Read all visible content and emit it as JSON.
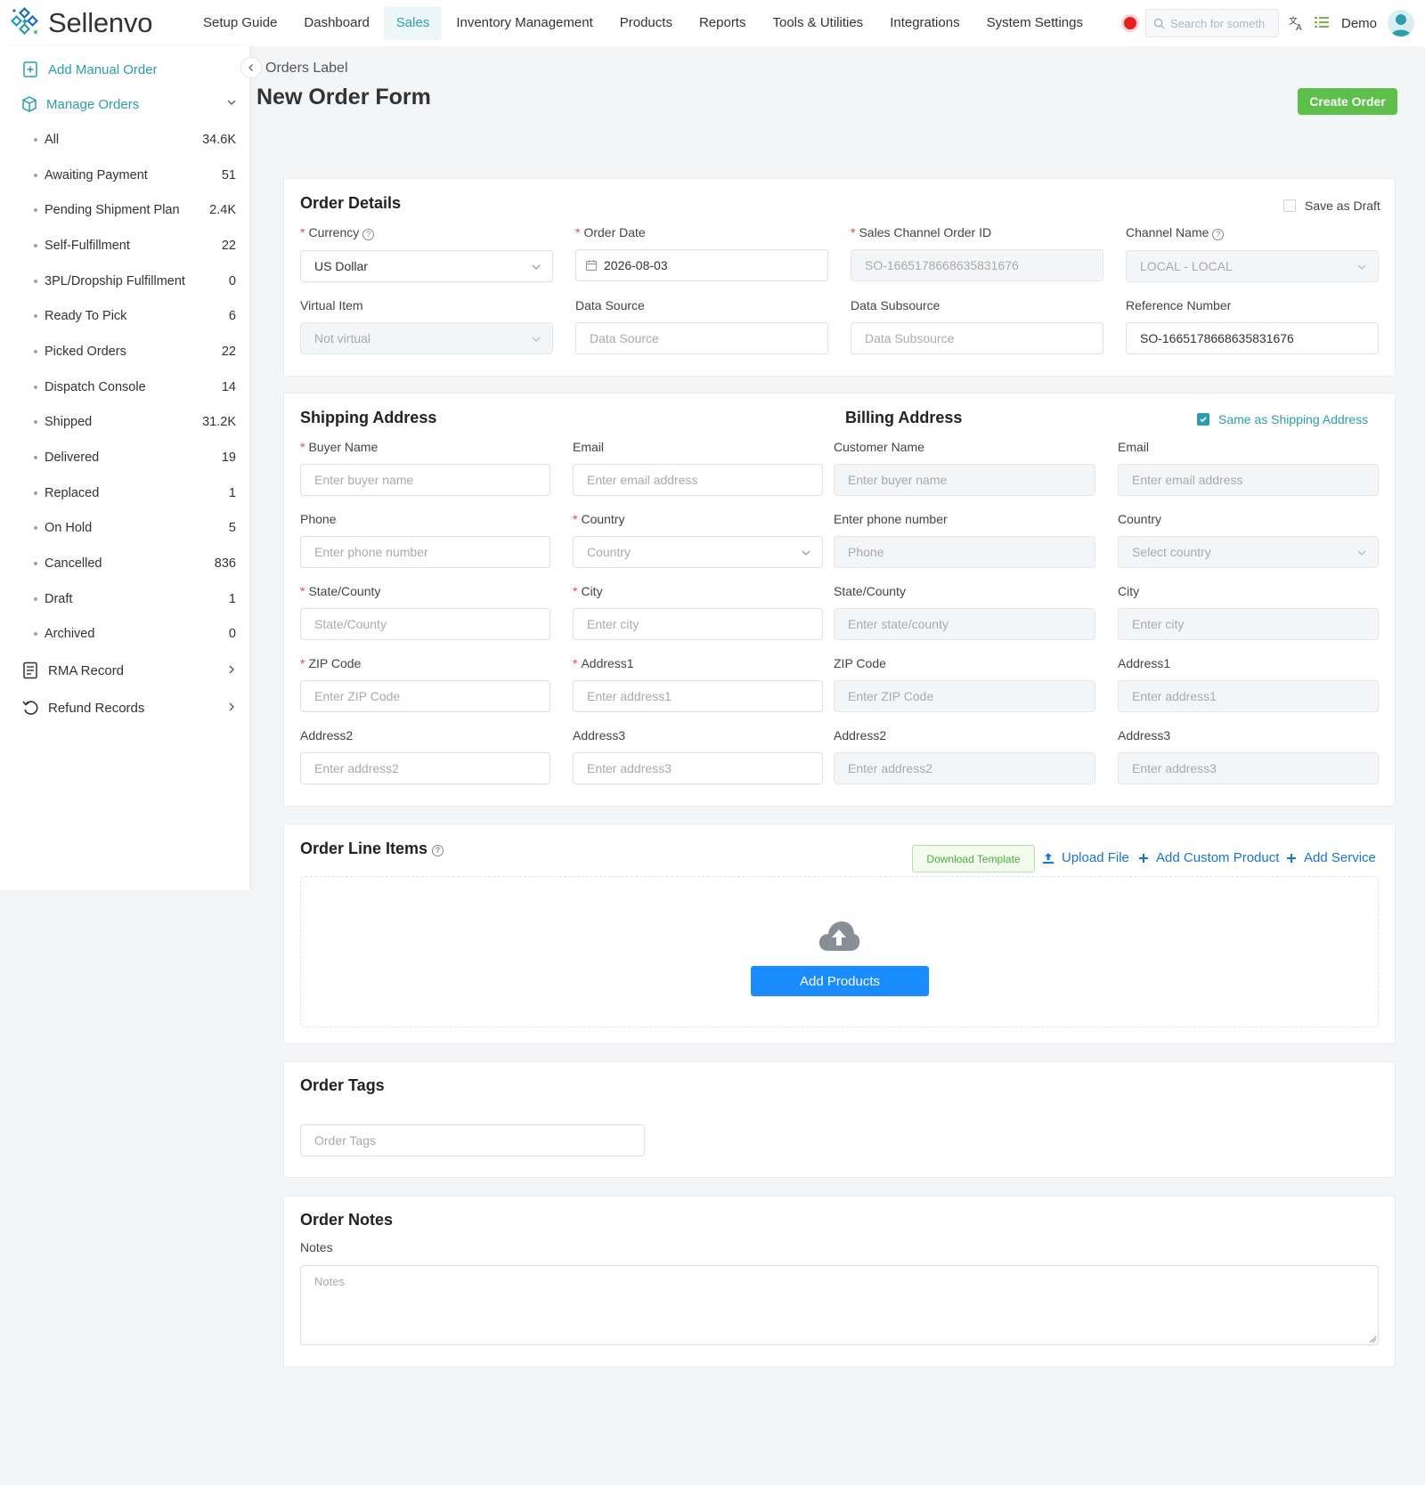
{
  "app": {
    "name": "Sellenvo"
  },
  "nav": {
    "items": [
      {
        "label": "Setup Guide"
      },
      {
        "label": "Dashboard"
      },
      {
        "label": "Sales"
      },
      {
        "label": "Inventory Management"
      },
      {
        "label": "Products"
      },
      {
        "label": "Reports"
      },
      {
        "label": "Tools & Utilities"
      },
      {
        "label": "Integrations"
      },
      {
        "label": "System Settings"
      }
    ],
    "active": "Sales",
    "search_placeholder": "Search for someth",
    "user": "Demo"
  },
  "sidebar": {
    "add_manual_order": "Add Manual Order",
    "manage_orders": "Manage Orders",
    "sub_items": [
      {
        "label": "All",
        "count": "34.6K"
      },
      {
        "label": "Awaiting Payment",
        "count": "51"
      },
      {
        "label": "Pending Shipment Plan",
        "count": "2.4K"
      },
      {
        "label": "Self-Fulfillment",
        "count": "22"
      },
      {
        "label": "3PL/Dropship Fulfillment",
        "count": "0"
      },
      {
        "label": "Ready To Pick",
        "count": "6"
      },
      {
        "label": "Picked Orders",
        "count": "22"
      },
      {
        "label": "Dispatch Console",
        "count": "14"
      },
      {
        "label": "Shipped",
        "count": "31.2K"
      },
      {
        "label": "Delivered",
        "count": "19"
      },
      {
        "label": "Replaced",
        "count": "1"
      },
      {
        "label": "On Hold",
        "count": "5"
      },
      {
        "label": "Cancelled",
        "count": "836"
      },
      {
        "label": "Draft",
        "count": "1"
      },
      {
        "label": "Archived",
        "count": "0"
      }
    ],
    "rma_record": "RMA Record",
    "refund_records": "Refund Records"
  },
  "page": {
    "breadcrumb": "Orders Label",
    "title": "New Order Form",
    "create_order": "Create Order"
  },
  "order_details": {
    "title": "Order Details",
    "save_as_draft": "Save as Draft",
    "save_as_draft_checked": false,
    "currency_label": "Currency",
    "currency_value": "US Dollar",
    "order_date_label": "Order Date",
    "order_date_value": "2026-08-03",
    "sales_channel_order_id_label": "Sales Channel Order ID",
    "sales_channel_order_id_value": "SO-1665178668635831676",
    "channel_name_label": "Channel Name",
    "channel_name_value": "LOCAL - LOCAL",
    "virtual_item_label": "Virtual Item",
    "virtual_item_value": "Not virtual",
    "data_source_label": "Data Source",
    "data_source_placeholder": "Data Source",
    "data_subsource_label": "Data Subsource",
    "data_subsource_placeholder": "Data Subsource",
    "reference_number_label": "Reference Number",
    "reference_number_value": "SO-1665178668635831676"
  },
  "shipping": {
    "title": "Shipping Address",
    "buyer_name_label": "Buyer Name",
    "buyer_name_ph": "Enter buyer name",
    "email_label": "Email",
    "email_ph": "Enter email address",
    "phone_label": "Phone",
    "phone_ph": "Enter phone number",
    "country_label": "Country",
    "country_ph": "Country",
    "state_label": "State/County",
    "state_ph": "State/County",
    "city_label": "City",
    "city_ph": "Enter city",
    "zip_label": "ZIP Code",
    "zip_ph": "Enter ZIP Code",
    "address1_label": "Address1",
    "address1_ph": "Enter address1",
    "address2_label": "Address2",
    "address2_ph": "Enter address2",
    "address3_label": "Address3",
    "address3_ph": "Enter address3"
  },
  "billing": {
    "title": "Billing Address",
    "same_as_shipping": "Same as Shipping Address",
    "same_as_shipping_checked": true,
    "customer_name_label": "Customer Name",
    "customer_name_ph": "Enter buyer name",
    "email_label": "Email",
    "email_ph": "Enter email address",
    "phone_label": "Enter phone number",
    "phone_ph": "Phone",
    "country_label": "Country",
    "country_ph": "Select country",
    "state_label": "State/County",
    "state_ph": "Enter state/county",
    "city_label": "City",
    "city_ph": "Enter city",
    "zip_label": "ZIP Code",
    "zip_ph": "Enter ZIP Code",
    "address1_label": "Address1",
    "address1_ph": "Enter address1",
    "address2_label": "Address2",
    "address2_ph": "Enter address2",
    "address3_label": "Address3",
    "address3_ph": "Enter address3"
  },
  "line_items": {
    "title": "Order Line Items",
    "download_template": "Download Template",
    "upload_file": "Upload File",
    "add_custom_product": "Add Custom Product",
    "add_service": "Add Service",
    "add_products": "Add Products"
  },
  "tags": {
    "title": "Order Tags",
    "placeholder": "Order Tags"
  },
  "notes": {
    "title": "Order Notes",
    "label": "Notes",
    "placeholder": "Notes"
  },
  "colors": {
    "brand_teal": "#2a9db0",
    "create_green": "#5cc04a",
    "link_blue": "#1677d2",
    "primary_blue": "#1a8cff",
    "required_red": "#e5484d"
  }
}
